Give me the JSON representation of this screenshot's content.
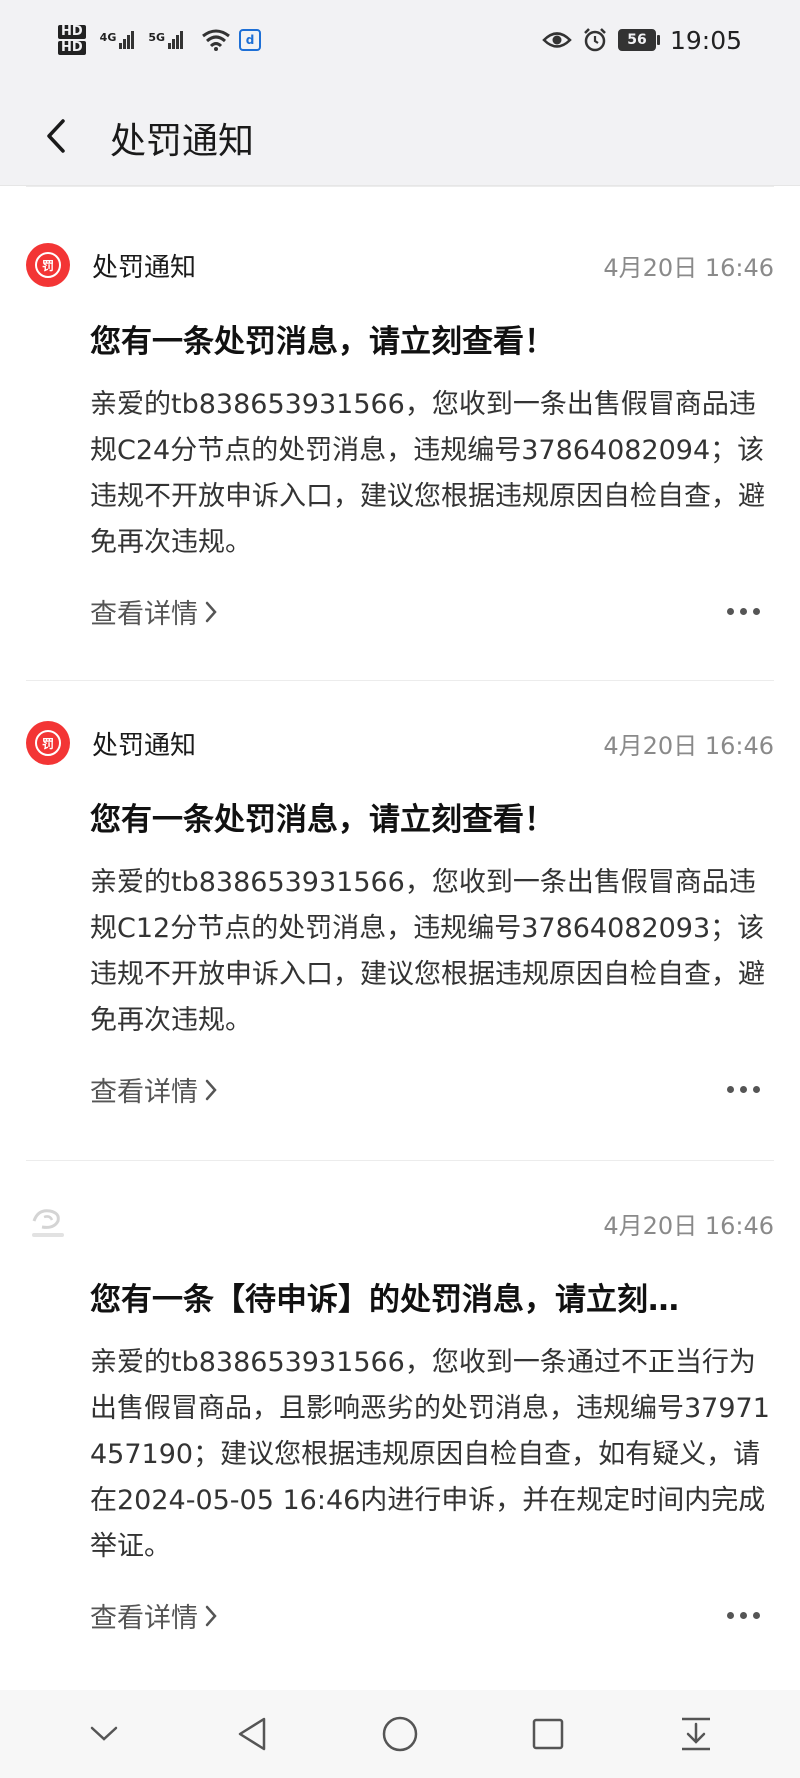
{
  "status_bar": {
    "hd1": "HD",
    "hd2": "HD",
    "net1": "4G",
    "net2": "5G",
    "app_badge": "d",
    "battery": "56",
    "time": "19:05"
  },
  "header": {
    "title": "处罚通知"
  },
  "messages": [
    {
      "source": "处罚通知",
      "icon_text": "罚",
      "time": "4月20日 16:46",
      "title": "您有一条处罚消息，请立刻查看！",
      "body": "亲爱的tb838653931566，您收到一条出售假冒商品违规C24分节点的处罚消息，违规编号37864082094；该违规不开放申诉入口，建议您根据违规原因自检自查，避免再次违规。",
      "link": "查看详情"
    },
    {
      "source": "处罚通知",
      "icon_text": "罚",
      "time": "4月20日 16:46",
      "title": "您有一条处罚消息，请立刻查看！",
      "body": "亲爱的tb838653931566，您收到一条出售假冒商品违规C12分节点的处罚消息，违规编号37864082093；该违规不开放申诉入口，建议您根据违规原因自检自查，避免再次违规。",
      "link": "查看详情"
    },
    {
      "source": "",
      "icon_text": "阿里巴巴",
      "time": "4月20日 16:46",
      "title": "您有一条【待申诉】的处罚消息，请立刻…",
      "body": "亲爱的tb838653931566，您收到一条通过不正当行为出售假冒商品，且影响恶劣的处罚消息，违规编号37971457190；建议您根据违规原因自检自查，如有疑义，请在2024-05-05 16:46内进行申诉，并在规定时间内完成举证。",
      "link": "查看详情"
    }
  ],
  "colors": {
    "accent_red": "#f33535",
    "header_bg": "#f2f2f4",
    "time_gray": "#8a8a8a"
  },
  "icons": {
    "back": "chevron-left-icon",
    "more": "more-horizontal-icon",
    "nav": [
      "chevron-down-icon",
      "back-triangle-icon",
      "home-circle-icon",
      "recents-square-icon",
      "download-tray-icon"
    ]
  }
}
